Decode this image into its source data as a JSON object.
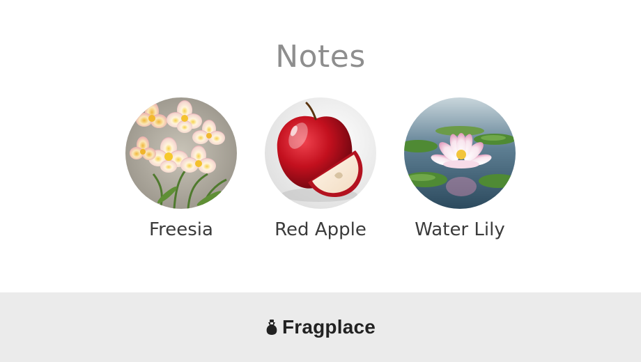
{
  "page": {
    "title": "Notes"
  },
  "notes": [
    {
      "label": "Freesia",
      "image": "freesia-flower-image"
    },
    {
      "label": "Red Apple",
      "image": "red-apple-image"
    },
    {
      "label": "Water Lily",
      "image": "water-lily-image"
    }
  ],
  "footer": {
    "brand": "Fragplace",
    "logo_icon": "fragplace-logo-icon",
    "background": "#ebebeb"
  },
  "colors": {
    "title": "#8e8e8e",
    "label": "#3b3b3b",
    "brand": "#222222"
  }
}
